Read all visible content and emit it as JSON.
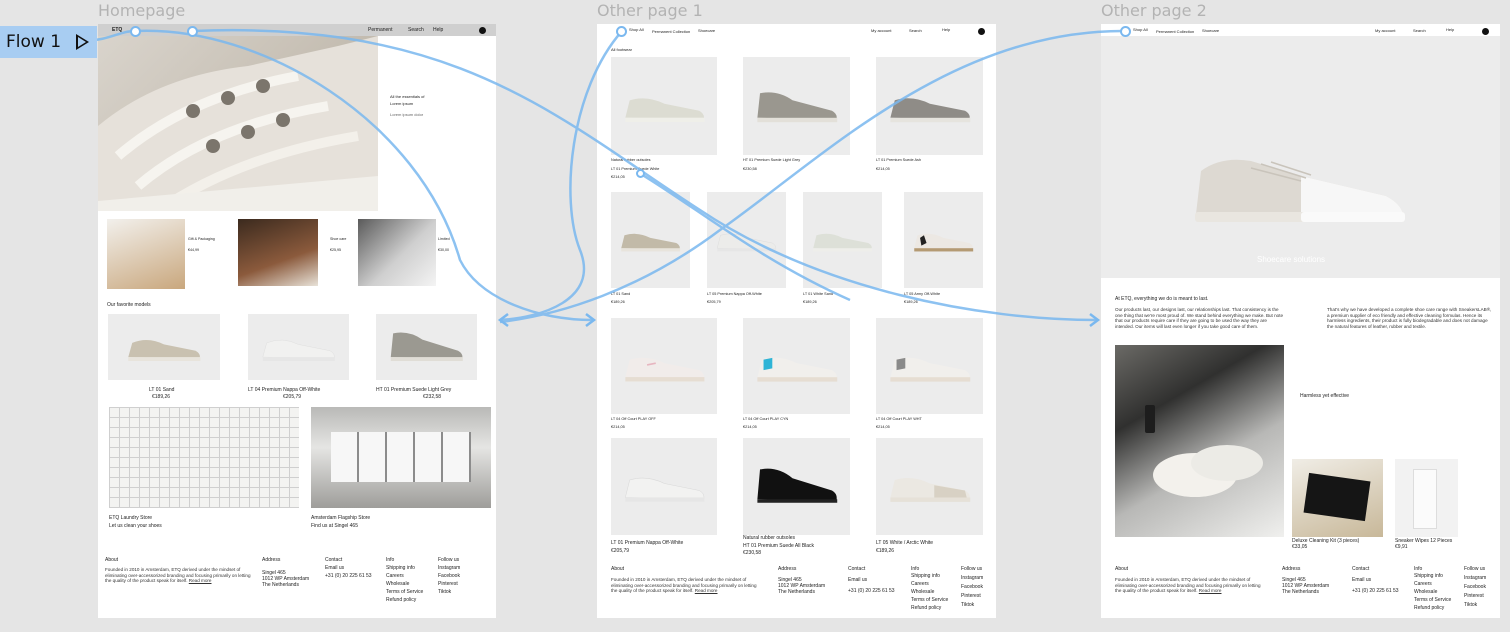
{
  "flow": {
    "label": "Flow 1"
  },
  "frames": {
    "home": {
      "label": "Homepage"
    },
    "other1": {
      "label": "Other page 1"
    },
    "other2": {
      "label": "Other page 2"
    }
  },
  "home": {
    "nav": {
      "logo": "ETQ",
      "links": [
        "Permanent",
        "Search",
        "Help"
      ]
    },
    "hero_text": [
      "All the essentials of",
      "Lorem ipsum",
      "Lorem ipsum dolor"
    ],
    "promos": [
      {
        "title": "Gift & Packaging",
        "price": "€44,99"
      },
      {
        "title": "Shoe care",
        "price": "€25,95"
      },
      {
        "title": "Limited",
        "price": "€30,00"
      }
    ],
    "fav_heading": "Our favorite models",
    "fav": [
      {
        "name": "LT 01 Sand",
        "price": "€189,26"
      },
      {
        "name": "LT 04 Premium Nappa Off-White",
        "price": "€205,79"
      },
      {
        "name": "HT 01 Premium Suede Light Grey",
        "price": "€232,58"
      }
    ],
    "stores": [
      {
        "name": "ETQ Laundry Store",
        "cta": "Let us clean your shoes"
      },
      {
        "name": "Amsterdam Flagship Store",
        "cta": "Find us at Singel 465"
      }
    ],
    "footer": {
      "about_h": "About",
      "about": "Founded in 2010 in Amsterdam, ETQ derived under the mindset of eliminating over-accessorized branding and focusing primarily on letting the quality of the product speak for itself.",
      "read_more": "Read more",
      "address_h": "Address",
      "address": [
        "Singel 465",
        "1012 WP Amsterdam",
        "The Netherlands"
      ],
      "contact_h": "Contact",
      "contact": [
        "Email us",
        "+31 (0) 20 225 61 53"
      ],
      "info_h": "Info",
      "info": [
        "Shipping info",
        "Careers",
        "Wholesale",
        "Terms of Service",
        "Refund policy"
      ],
      "follow_h": "Follow us",
      "follow": [
        "Instagram",
        "Facebook",
        "Pinterest",
        "Tiktok"
      ]
    }
  },
  "other1": {
    "nav": {
      "links": [
        "Shop All",
        "Permanent Collection",
        "Shoecare"
      ],
      "right": [
        "My account",
        "Search",
        "Help"
      ]
    },
    "section": "All footwear",
    "row1": [
      {
        "name": "Natural rubber outsoles",
        "sub": "LT 01 Premium Suede White",
        "price": "€214,05"
      },
      {
        "name": "HT 01 Premium Suede Light Grey",
        "price": "€230,58"
      },
      {
        "name": "LT 01 Premium Suede Ash",
        "price": "€214,05"
      }
    ],
    "row2": [
      {
        "name": "LT 01 Sand",
        "price": "€189,26"
      },
      {
        "name": "LT 05 Premium Nappa Off-White",
        "price": "€205,79"
      },
      {
        "name": "LT 01 White Sand",
        "price": "€189,26"
      },
      {
        "name": "LT 05 Army Off-White",
        "price": "€189,26"
      }
    ],
    "row3": [
      {
        "name": "LT 04 Off Court PLAY OFF",
        "price": "€214,05"
      },
      {
        "name": "LT 04 Off Court PLAY CYN",
        "price": "€214,05"
      },
      {
        "name": "LT 04 Off Court PLAY WHT",
        "price": "€214,05"
      }
    ],
    "row4": [
      {
        "name": "LT 01 Premium Nappa Off-White",
        "price": "€205,79"
      },
      {
        "name": "Natural rubber outsoles",
        "sub": "HT 01 Premium Suede All Black",
        "price": "€230,58"
      },
      {
        "name": "LT 05 White / Arctic White",
        "price": "€189,26"
      }
    ]
  },
  "other2": {
    "nav": {
      "links": [
        "Shop All",
        "Permanent Collection",
        "Shoecare"
      ],
      "right": [
        "My account",
        "Search",
        "Help"
      ]
    },
    "hero_caption": "Shoecare solutions",
    "intro_h": "At ETQ, everything we do is meant to last.",
    "intro": "Our products last, our designs last, our relationships last. That consistency is the one thing that we're most proud of. We stand behind everything we make. But note that our products require care if they are going to be used the way they are intended. Our items will last even longer if you take good care of them.",
    "intro2": "That's why we have developed a complete shoe care range with SneakersLAB®, a premium supplier of eco friendly and effective cleaning formulas. Hence its harmless ingredients, their product is fully biodegradable and does not damage the natural features of leather, rubber and textile.",
    "harmless": "Harmless yet effective",
    "products": [
      {
        "name": "Deluxe Cleaning Kit (3 pieces)",
        "price": "€33,05"
      },
      {
        "name": "Sneaker Wipes 12 Pieces",
        "price": "€9,91"
      }
    ]
  },
  "colors": {
    "flow": "#7ab8ef",
    "flow_tag": "#a8cdf2",
    "canvas": "#e5e5e5"
  }
}
